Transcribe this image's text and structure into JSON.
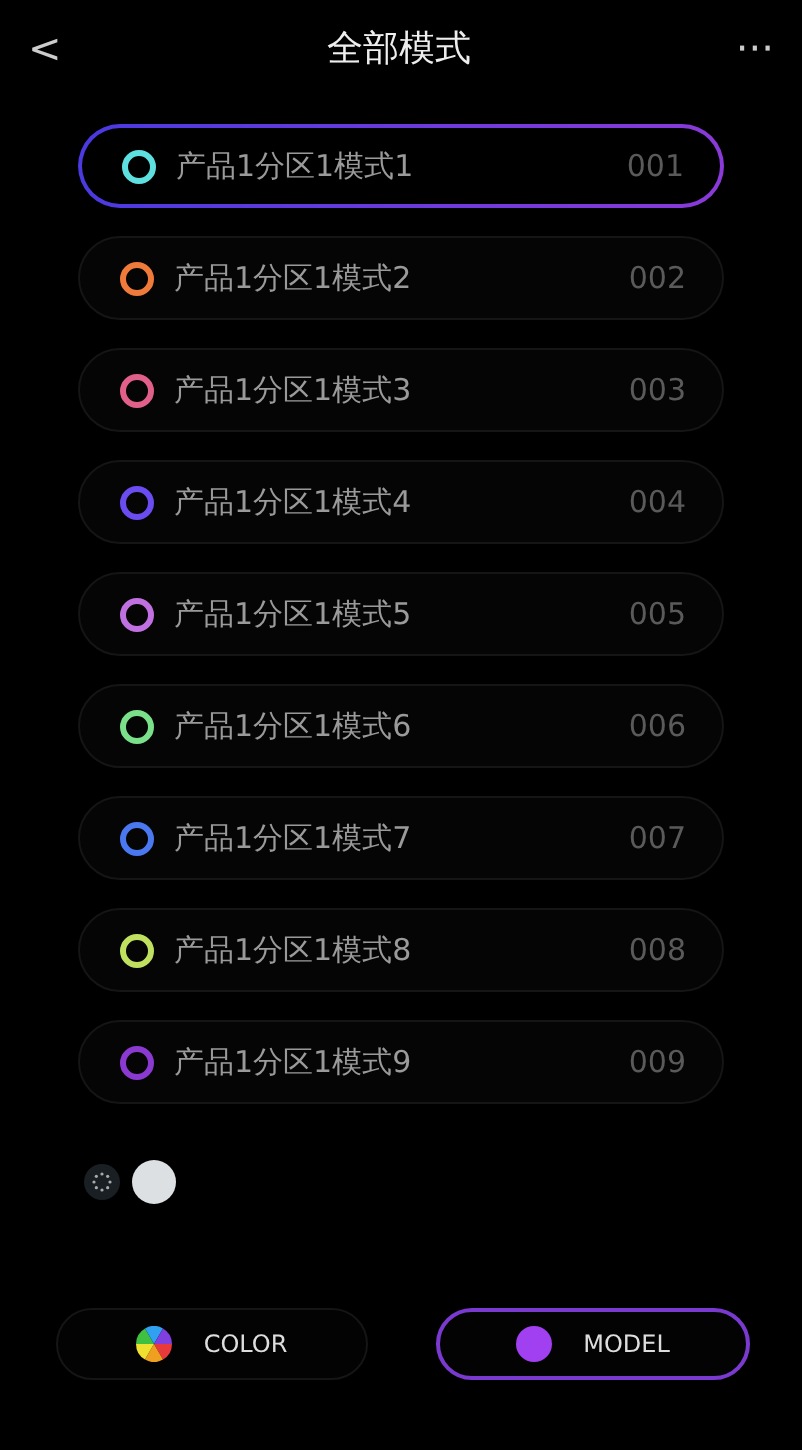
{
  "header": {
    "back": "<",
    "title": "全部模式",
    "more": "···"
  },
  "modes": [
    {
      "name": "产品1分区1模式1",
      "code": "001",
      "color": "#5ee0e0",
      "selected": true
    },
    {
      "name": "产品1分区1模式2",
      "code": "002",
      "color": "#f07a3a",
      "selected": false
    },
    {
      "name": "产品1分区1模式3",
      "code": "003",
      "color": "#e0608a",
      "selected": false
    },
    {
      "name": "产品1分区1模式4",
      "code": "004",
      "color": "#6a4cf0",
      "selected": false
    },
    {
      "name": "产品1分区1模式5",
      "code": "005",
      "color": "#c070e0",
      "selected": false
    },
    {
      "name": "产品1分区1模式6",
      "code": "006",
      "color": "#7ae08a",
      "selected": false
    },
    {
      "name": "产品1分区1模式7",
      "code": "007",
      "color": "#4a78f0",
      "selected": false
    },
    {
      "name": "产品1分区1模式8",
      "code": "008",
      "color": "#c0e060",
      "selected": false
    },
    {
      "name": "产品1分区1模式9",
      "code": "009",
      "color": "#8a3ad0",
      "selected": false
    }
  ],
  "tabs": [
    {
      "label": "COLOR",
      "kind": "wheel",
      "selected": false
    },
    {
      "label": "MODEL",
      "kind": "dot",
      "selected": true
    }
  ]
}
